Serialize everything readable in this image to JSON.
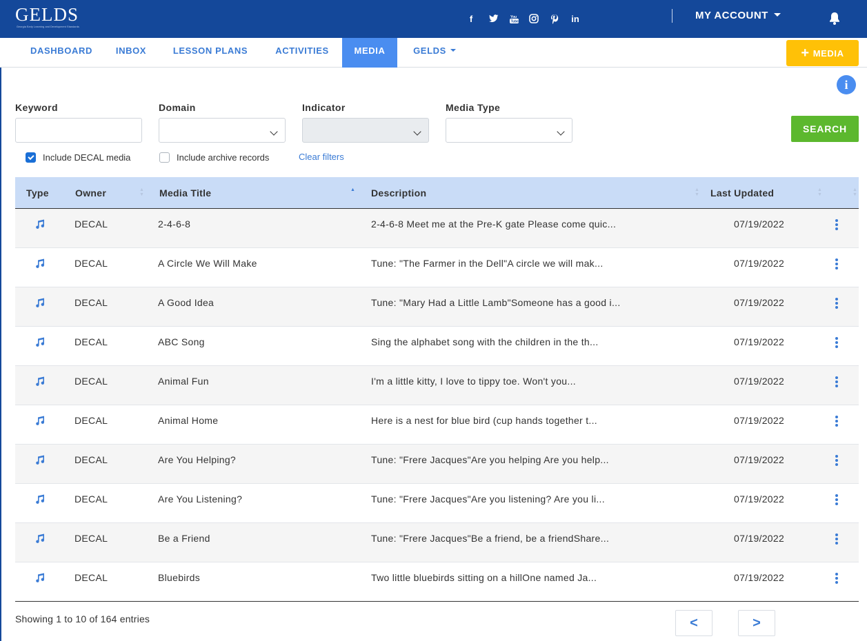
{
  "header": {
    "logo": "GELDS",
    "logo_tagline": "Georgia Early Learning and Development Standards",
    "social": [
      {
        "label": "f",
        "icon": "facebook-icon"
      },
      {
        "label": "🐦",
        "icon": "twitter-icon"
      },
      {
        "label": "You Tube",
        "icon": "youtube-icon"
      },
      {
        "label": "◎",
        "icon": "instagram-icon"
      },
      {
        "label": "℗",
        "icon": "pinterest-icon"
      },
      {
        "label": "in",
        "icon": "linkedin-icon"
      }
    ],
    "account_label": "MY ACCOUNT",
    "bg_color": "#14489a"
  },
  "nav": {
    "items": [
      {
        "label": "DASHBOARD"
      },
      {
        "label": "INBOX"
      },
      {
        "label": "LESSON PLANS"
      },
      {
        "label": "ACTIVITIES"
      },
      {
        "label": "MEDIA",
        "active": true
      },
      {
        "label": "GELDS"
      }
    ],
    "add_media_label": "MEDIA",
    "accent": "#4a8df0",
    "add_color": "#ffc107"
  },
  "filters": {
    "keyword_label": "Keyword",
    "keyword_value": "",
    "domain_label": "Domain",
    "domain_value": "",
    "indicator_label": "Indicator",
    "indicator_value": "",
    "media_type_label": "Media Type",
    "media_type_value": "",
    "include_decal_label": "Include DECAL media",
    "include_decal_checked": true,
    "include_archive_label": "Include archive records",
    "include_archive_checked": false,
    "clear_label": "Clear filters",
    "search_label": "SEARCH",
    "info_glyph": "i",
    "search_color": "#5cb82e"
  },
  "table": {
    "columns": [
      "Type",
      "Owner",
      "Media Title",
      "Description",
      "Last Updated"
    ],
    "sorted_column": "Media Title",
    "rows": [
      {
        "type": "music-icon",
        "owner": "DECAL",
        "title": "2-4-6-8",
        "description": "2-4-6-8 Meet me at the Pre-K gate Please come quic...",
        "updated": "07/19/2022"
      },
      {
        "type": "music-icon",
        "owner": "DECAL",
        "title": "A Circle We Will Make",
        "description": "Tune: \"The Farmer in the Dell\"A circle we will mak...",
        "updated": "07/19/2022"
      },
      {
        "type": "music-icon",
        "owner": "DECAL",
        "title": "A Good Idea",
        "description": "Tune: \"Mary Had a Little Lamb\"Someone has a good i...",
        "updated": "07/19/2022"
      },
      {
        "type": "music-icon",
        "owner": "DECAL",
        "title": "ABC Song",
        "description": "Sing the alphabet song with the children in the th...",
        "updated": "07/19/2022"
      },
      {
        "type": "music-icon",
        "owner": "DECAL",
        "title": "Animal Fun",
        "description": "I'm a little kitty, I love to tippy toe. Won't you...",
        "updated": "07/19/2022"
      },
      {
        "type": "music-icon",
        "owner": "DECAL",
        "title": "Animal Home",
        "description": "Here is a nest for blue bird (cup hands together t...",
        "updated": "07/19/2022"
      },
      {
        "type": "music-icon",
        "owner": "DECAL",
        "title": "Are You Helping?",
        "description": "Tune: \"Frere Jacques\"Are you helping  Are you help...",
        "updated": "07/19/2022"
      },
      {
        "type": "music-icon",
        "owner": "DECAL",
        "title": "Are You Listening?",
        "description": "Tune: \"Frere Jacques\"Are you listening? Are you li...",
        "updated": "07/19/2022"
      },
      {
        "type": "music-icon",
        "owner": "DECAL",
        "title": "Be a Friend",
        "description": "Tune: \"Frere Jacques\"Be a friend, be a friendShare...",
        "updated": "07/19/2022"
      },
      {
        "type": "music-icon",
        "owner": "DECAL",
        "title": "Bluebirds",
        "description": "Two little bluebirds sitting on a hillOne named Ja...",
        "updated": "07/19/2022"
      }
    ],
    "header_bg": "#c9dcf7"
  },
  "pagination": {
    "info": "Showing 1 to 10 of 164 entries",
    "prev_label": "<",
    "next_label": ">"
  }
}
